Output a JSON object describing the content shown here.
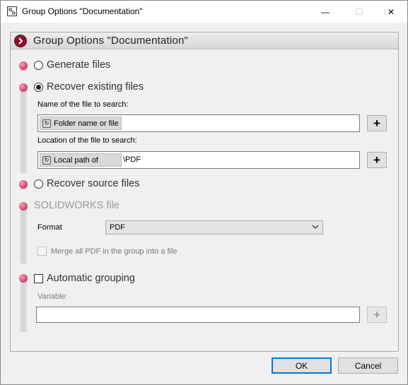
{
  "window": {
    "title": "Group Options \"Documentation\"",
    "minimize_glyph": "—",
    "maximize_glyph": "☐",
    "close_glyph": "✕"
  },
  "panel": {
    "title": "Group Options \"Documentation\""
  },
  "options": {
    "generate_files": {
      "label": "Generate files",
      "selected": false
    },
    "recover_existing": {
      "label": "Recover existing files",
      "selected": true,
      "name_label": "Name of the file to search:",
      "name_chip": "Folder name or file",
      "name_value": "",
      "location_label": "Location of the file to search:",
      "location_chip": "Local path of",
      "location_value": "\\PDF"
    },
    "recover_source": {
      "label": "Recover source files",
      "selected": false
    }
  },
  "solidworks": {
    "label": "SOLIDWORKS file",
    "format_label": "Format",
    "format_value": "PDF",
    "merge_label": "Merge all PDF in the group into a file",
    "merge_checked": false
  },
  "grouping": {
    "label": "Automatic grouping",
    "checked": false,
    "variable_label": "Variable:",
    "variable_value": ""
  },
  "buttons": {
    "plus": "+",
    "ok": "OK",
    "cancel": "Cancel"
  },
  "colors": {
    "accent": "#d8466c",
    "header_icon": "#8a1330",
    "primary_border": "#0078d7"
  }
}
